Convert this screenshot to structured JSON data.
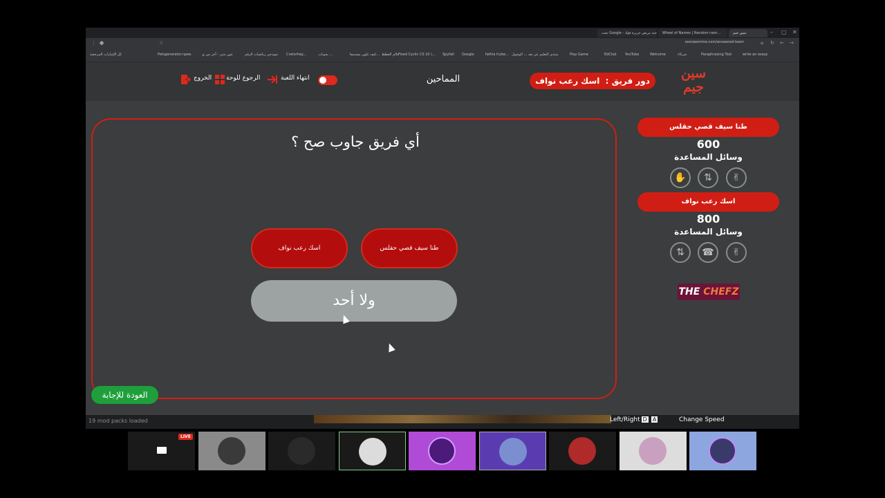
{
  "browser": {
    "tabs": [
      "Wheel of Names | Random nam...",
      "بحث Google - شاحنة مريض جزيرة فؤاد",
      "سين جيم"
    ],
    "url": "seenjeemme.com/answered-team",
    "bookmarks": [
      "كل الإشارات المرجعية",
      "Pelsgenerator.npee.",
      "عون شي - آخر من ي",
      "نموذجي رياضيات الرقم",
      "Cratorhay...",
      "بحوبات ...",
      "كيف تكون مستمعا...",
      "عالم القطط",
      "Fixed Cyclic CS 10 (...",
      "Spyfall",
      "Google",
      "fathia trybe...",
      "الوصول ...",
      "منتدى التعليم عن بعد",
      "Play Game",
      "EdClub",
      "YouTube",
      "Welcome",
      "شركاء",
      "Paraphrasing Tool",
      "write an essay"
    ]
  },
  "header": {
    "logo_text": "سين جيم",
    "turn_prefix": "دور فريق :",
    "turn_team": "اسك رعب نواف",
    "title": "المماحين",
    "end_game": "انتهاء اللعبة",
    "back_to_board": "الرجوع للوحة",
    "exit": "الخروج"
  },
  "question": {
    "text": "أي فريق جاوب صح ؟",
    "team_a_button": "اسك رعب نواف",
    "team_b_button": "طنا سيف قصي حقلس",
    "none_button": "ولا أحد",
    "back_to_answer": "العودة للإجابة"
  },
  "scoreboard": {
    "teams": [
      {
        "name": "طنا سيف قصي حقلس",
        "score": "600",
        "helpers_label": "وسائل المساعدة",
        "aids": [
          "hand-icon",
          "swap-icon",
          "two-fingers-icon"
        ]
      },
      {
        "name": "اسك رعب نواف",
        "score": "800",
        "helpers_label": "وسائل المساعدة",
        "aids": [
          "swap-icon",
          "phone-icon",
          "two-fingers-icon"
        ]
      }
    ]
  },
  "sponsor": {
    "part1": "THE ",
    "part2": "CHEFZ"
  },
  "stream": {
    "mods_text": "19 mod packs loaded",
    "left_right_label": "Left/Right",
    "key_d": "D",
    "key_a": "A",
    "change_speed": "Change Speed"
  },
  "participants": {
    "live_badge": "LIVE"
  },
  "colors": {
    "accent_red": "#d11e14",
    "green": "#1e9f3c",
    "panel_bg": "#3b3d3e"
  }
}
